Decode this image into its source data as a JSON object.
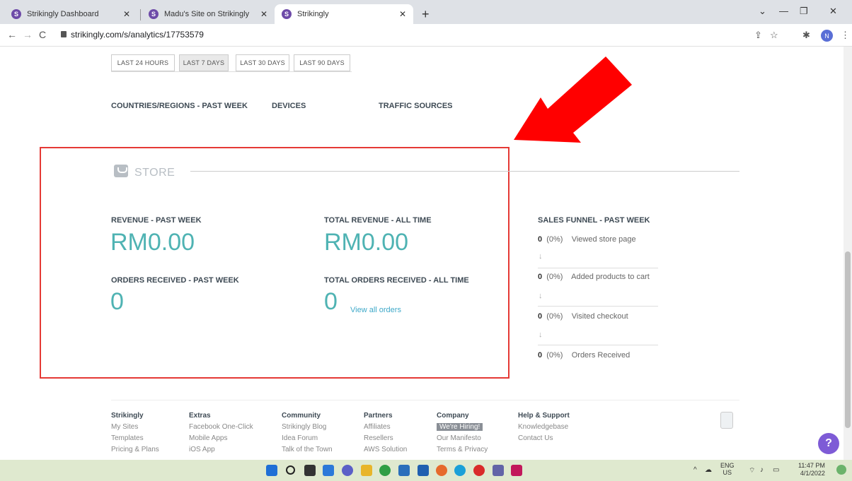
{
  "browser": {
    "tabs": [
      {
        "label": "Strikingly Dashboard"
      },
      {
        "label": "Madu's Site on Strikingly"
      },
      {
        "label": "Strikingly"
      }
    ],
    "url": "strikingly.com/s/analytics/17753579",
    "avatar_letter": "N",
    "favicon_letter": "S"
  },
  "ranges": [
    {
      "label": "LAST 24 HOURS",
      "active": false
    },
    {
      "label": "LAST 7 DAYS",
      "active": true
    },
    {
      "label": "LAST 30 DAYS",
      "active": false
    },
    {
      "label": "LAST 90 DAYS",
      "active": false
    }
  ],
  "subheads": {
    "countries": "COUNTRIES/REGIONS - PAST WEEK",
    "devices": "DEVICES",
    "traffic": "TRAFFIC SOURCES"
  },
  "store": {
    "title": "STORE",
    "revenue_week_label": "REVENUE - PAST WEEK",
    "revenue_week_value": "RM0.00",
    "revenue_all_label": "TOTAL REVENUE - ALL TIME",
    "revenue_all_value": "RM0.00",
    "orders_week_label": "ORDERS RECEIVED - PAST WEEK",
    "orders_week_value": "0",
    "orders_all_label": "TOTAL ORDERS RECEIVED - ALL TIME",
    "orders_all_value": "0",
    "view_orders_link": "View all orders"
  },
  "funnel": {
    "title": "SALES FUNNEL - PAST WEEK",
    "steps": [
      {
        "count": "0",
        "pct": "(0%)",
        "label": "Viewed store page"
      },
      {
        "count": "0",
        "pct": "(0%)",
        "label": "Added products to cart"
      },
      {
        "count": "0",
        "pct": "(0%)",
        "label": "Visited checkout"
      },
      {
        "count": "0",
        "pct": "(0%)",
        "label": "Orders Received"
      }
    ],
    "arrow": "↓"
  },
  "footer": {
    "columns": [
      {
        "heading": "Strikingly",
        "items": [
          "My Sites",
          "Templates",
          "Pricing & Plans"
        ]
      },
      {
        "heading": "Extras",
        "items": [
          "Facebook One-Click",
          "Mobile Apps",
          "iOS App"
        ]
      },
      {
        "heading": "Community",
        "items": [
          "Strikingly Blog",
          "Idea Forum",
          "Talk of the Town"
        ]
      },
      {
        "heading": "Partners",
        "items": [
          "Affiliates",
          "Resellers",
          "AWS Solution"
        ]
      },
      {
        "heading": "Company",
        "items": [
          "We're Hiring!",
          "Our Manifesto",
          "Terms & Privacy"
        ]
      },
      {
        "heading": "Help & Support",
        "items": [
          "Knowledgebase",
          "Contact Us"
        ]
      }
    ],
    "help_label": "?"
  },
  "taskbar": {
    "lang": "ENG",
    "region": "US",
    "time": "11:47 PM",
    "date": "4/1/2022"
  },
  "colors": {
    "accent": "#4fb3b3",
    "highlight_box": "#e53935",
    "arrow": "#ff0000",
    "help_button": "#7e5bd6"
  }
}
